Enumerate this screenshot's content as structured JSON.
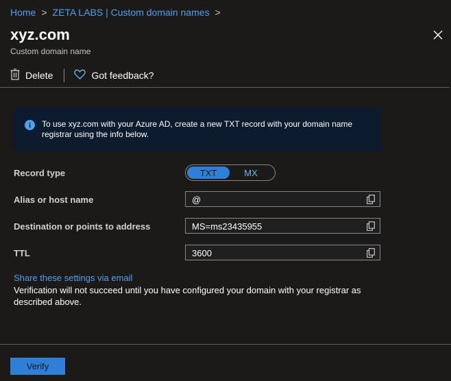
{
  "breadcrumb": {
    "items": [
      "Home",
      "ZETA LABS | Custom domain names"
    ],
    "separator": ">"
  },
  "header": {
    "title": "xyz.com",
    "subtitle": "Custom domain name"
  },
  "toolbar": {
    "delete_label": "Delete",
    "feedback_label": "Got feedback?"
  },
  "info": {
    "text": "To use xyz.com with your Azure AD, create a new TXT record with your domain name registrar using the info below."
  },
  "form": {
    "record_type_label": "Record type",
    "record_type_options": [
      "TXT",
      "MX"
    ],
    "record_type_selected": "TXT",
    "alias_label": "Alias or host name",
    "alias_value": "@",
    "destination_label": "Destination or points to address",
    "destination_value": "MS=ms23435955",
    "ttl_label": "TTL",
    "ttl_value": "3600"
  },
  "share_link": "Share these settings via email",
  "verification_note": "Verification will not succeed until you have configured your domain with your registrar as described above.",
  "footer": {
    "verify_label": "Verify"
  },
  "colors": {
    "background": "#1b1a19",
    "accent": "#2f7fd8",
    "link": "#4ea1ef",
    "info_background": "#0d1b2e"
  }
}
